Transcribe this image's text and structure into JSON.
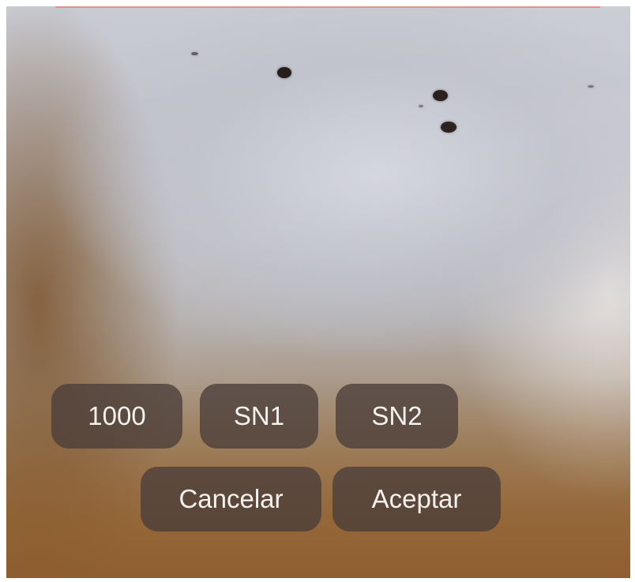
{
  "keypad": {
    "row1": {
      "key1_label": "1000",
      "key2_label": "SN1",
      "key3_label": "SN2"
    },
    "row2": {
      "cancel_label": "Cancelar",
      "accept_label": "Aceptar"
    }
  },
  "colors": {
    "button_background": "#4a3e3a",
    "button_text": "#f4f1ee",
    "top_accent_line": "#e58e8e"
  }
}
